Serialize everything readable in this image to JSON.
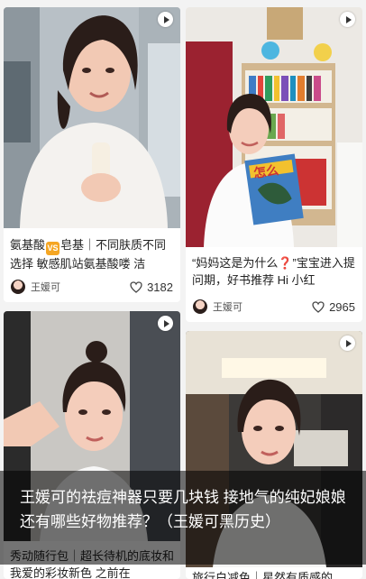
{
  "cards": [
    {
      "title_pre": "氨基酸",
      "title_badge": "VS",
      "title_post": "皂基｜不同肤质不同选择 敏感肌站氨基酸喽 洁",
      "author": "王媛可",
      "likes": "3182",
      "icons": {
        "play": "play-icon",
        "like": "heart-icon"
      }
    },
    {
      "title": "“妈妈这是为什么❓”宝宝进入提问期，好书推荐 Hi 小红",
      "author": "王媛可",
      "likes": "2965",
      "cover_text": "怎么",
      "icons": {
        "play": "play-icon",
        "like": "heart-icon"
      }
    },
    {
      "title": "秀动随行包｜超长待机的底妆和我爱的彩妆新色 之前在",
      "icons": {
        "play": "play-icon"
      }
    },
    {
      "title": "旅行白减色｜星然有质感的",
      "icons": {
        "play": "play-icon"
      }
    }
  ],
  "banner": {
    "text": "王媛可的祛痘神器只要几块钱  接地气的纯妃娘娘还有哪些好物推荐？（王媛可黑历史）"
  },
  "colors": {
    "background": "#f3f3f3",
    "banner_overlay": "rgba(0,0,0,0.55)",
    "badge": "#f5a623"
  }
}
